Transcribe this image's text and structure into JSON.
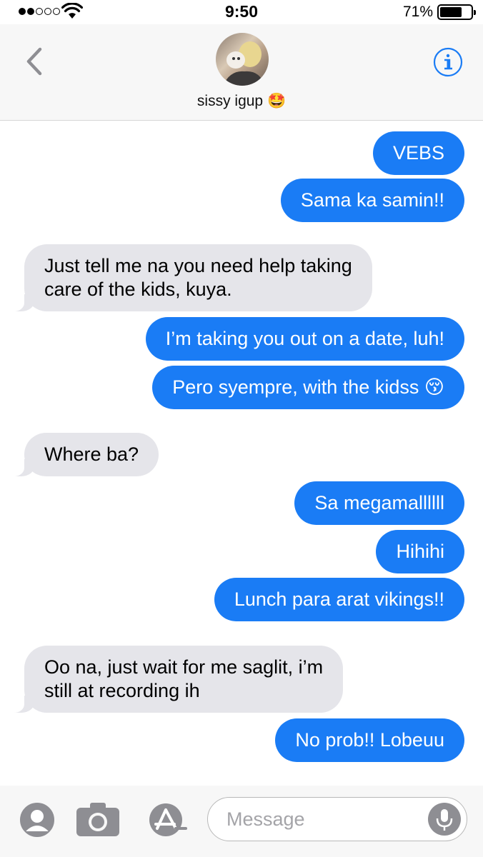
{
  "status_bar": {
    "time": "9:50",
    "battery": "71%",
    "battery_level": 0.71,
    "signal_bars_filled": 2,
    "signal_bars_total": 5
  },
  "header": {
    "contact_name": "sissy igup 🤩"
  },
  "messages": [
    {
      "direction": "sent",
      "text": "VEBS"
    },
    {
      "direction": "sent",
      "text": "Sama ka samin!!"
    },
    {
      "direction": "received",
      "text": "Just tell me na you need help taking\ncare of the kids, kuya."
    },
    {
      "direction": "sent",
      "text": "I’m taking you out on a date, luh!"
    },
    {
      "direction": "sent",
      "text": "Pero syempre, with the kidss 😚"
    },
    {
      "direction": "received",
      "text": "Where ba?"
    },
    {
      "direction": "sent",
      "text": "Sa megamallllll"
    },
    {
      "direction": "sent",
      "text": "Hihihi"
    },
    {
      "direction": "sent",
      "text": "Lunch para arat vikings!!"
    },
    {
      "direction": "received",
      "text": "Oo na, just wait for me saglit, i’m\nstill at recording ih"
    },
    {
      "direction": "sent",
      "text": "No prob!! Lobeuu"
    }
  ],
  "input": {
    "placeholder": "Message"
  },
  "icons": {
    "back": "chevron-left-icon",
    "info": "info-icon",
    "contact": "person-icon",
    "camera": "camera-icon",
    "apps": "app-store-icon",
    "mic": "microphone-icon"
  },
  "colors": {
    "accent": "#1a7cf5",
    "received_bubble": "#e5e5ea",
    "icon_gray": "#8e8e93"
  }
}
